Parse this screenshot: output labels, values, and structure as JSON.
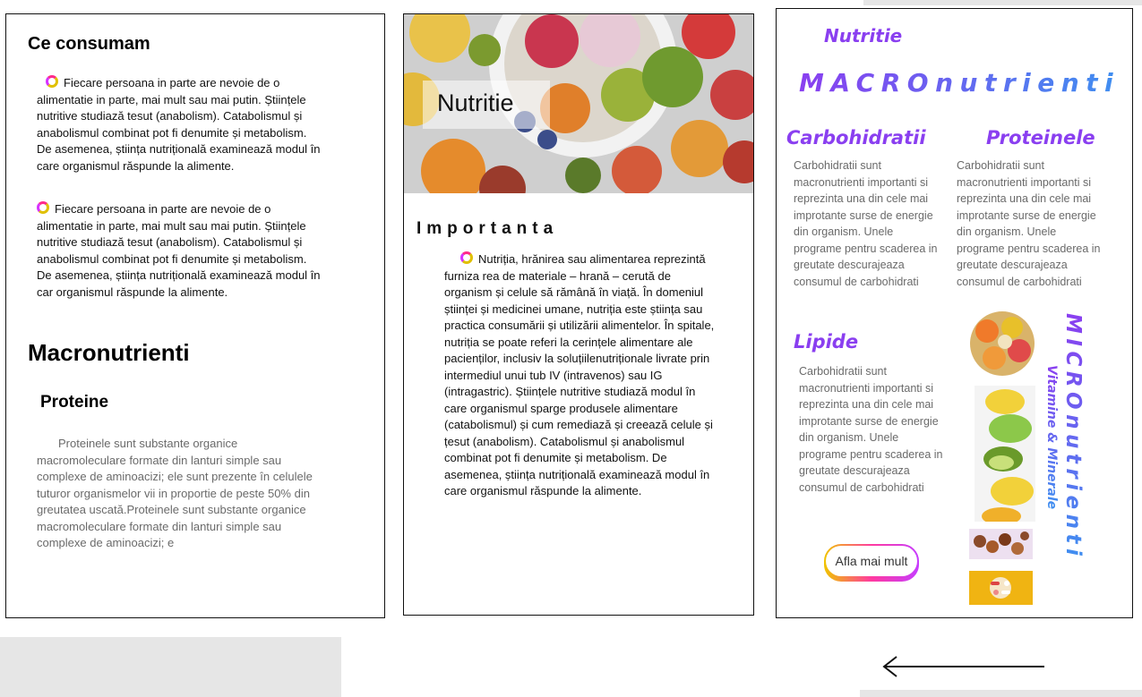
{
  "left_panel": {
    "title": "Ce consumam",
    "paragraph1": "Fiecare persoana in parte are nevoie de o alimentatie in parte, mai mult sau mai putin. Științele nutritive studiază  tesut (anabolism). Catabolismul și anabolismul combinat pot fi denumite și metabolism. De asemenea, știința nutrițională examinează modul în care organismul răspunde la alimente.",
    "paragraph2": "Fiecare persoana in parte are nevoie de o alimentatie in parte, mai mult sau mai putin. Științele nutritive studiază tesut (anabolism). Catabolismul și anabolismul combinat pot fi denumite și metabolism. De asemenea, știința nutrițională examinează modul în car organismul răspunde la alimente.",
    "heading": "Macronutrienti",
    "subheading": "Proteine",
    "body": "Proteinele sunt substante organice macromoleculare formate din lanturi simple sau complexe de aminoacizi; ele sunt prezente în celulele tuturor organismelor vii in proportie de peste 50% din greutatea uscată.Proteinele sunt substante organice macromoleculare formate din lanturi simple sau complexe de aminoacizi; e"
  },
  "middle_panel": {
    "hero_label": "Nutritie",
    "heading": "Importanta",
    "body": "Nutriția, hrănirea sau alimentarea reprezintă furniza rea de materiale – hrană – cerută de organism și celule să rămână în viață. În domeniul științei și medicinei umane, nutriția este știința sau practica consumării și utilizării alimentelor. În spitale, nutriția se poate referi la cerințele alimentare ale pacienților, inclusiv la soluțiilenutriționale livrate prin intermediul unui tub IV (intravenos) sau IG (intragastric). Științele nutritive studiază modul în care organismul sparge produsele alimentare (catabolismul) și cum remediază și creează celule și țesut (anabolism). Catabolismul și anabolismul combinat pot fi denumite și metabolism. De asemenea, știința nutrițională examinează modul în care organismul răspunde la alimente."
  },
  "right_panel": {
    "top_label": "Nutritie",
    "macro_title": "MACROnutrienti",
    "carbs_heading": "Carbohidratii",
    "carbs_text": "Carbohidratii sunt macronutrienti importanti si reprezinta una din cele mai improtante surse de energie din organism. Unele programe pentru scaderea in greutate descurajeaza consumul de carbohidrati",
    "proteins_heading": "Proteinele",
    "proteins_text": "Carbohidratii sunt macronutrienti importanti si reprezinta una din cele mai improtante surse de energie din organism. Unele programe pentru scaderea in greutate descurajeaza consumul de carbohidrati",
    "lipids_heading": "Lipide",
    "lipids_text": "Carbohidratii sunt macronutrienti importanti si reprezinta una din cele mai improtante surse de energie din organism. Unele programe pentru scaderea in greutate descurajeaza consumul de carbohidrati",
    "button_label": "Afla mai mult",
    "micro_title": "MICROnutrienti",
    "micro_subtitle": "Vitamine & Minerale"
  },
  "colors": {
    "purple": "#8a3ff0",
    "blue": "#3f8ff0",
    "border": "#111111",
    "grey_block": "#e6e6e6"
  },
  "icons": [
    "bullet-ring-icon",
    "back-arrow-icon"
  ]
}
